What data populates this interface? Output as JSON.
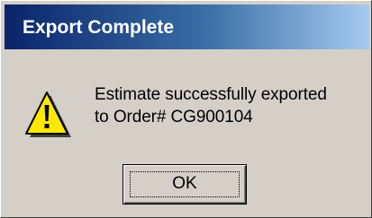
{
  "dialog": {
    "title": "Export Complete",
    "icon": "warning-icon",
    "message_line1": "Estimate successfully exported",
    "message_line2": "to Order# CG900104",
    "ok_label": "OK"
  },
  "colors": {
    "titlebar_start": "#0a246a",
    "titlebar_end": "#a6caf0",
    "face": "#d4d0c8",
    "icon_fill": "#ffe800"
  }
}
